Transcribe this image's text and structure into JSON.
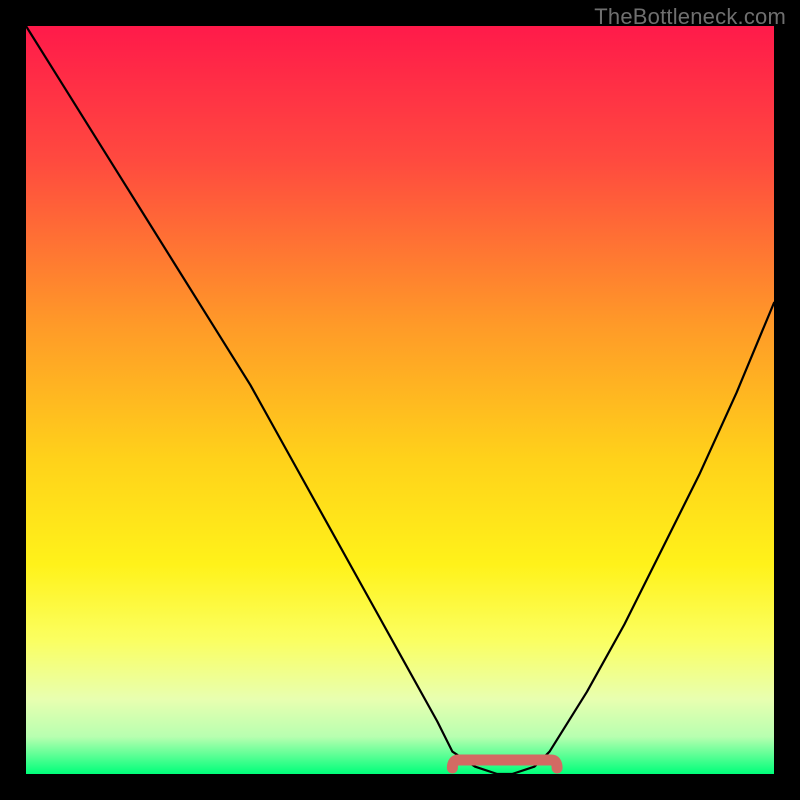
{
  "watermark": "TheBottleneck.com",
  "chart_data": {
    "type": "line",
    "title": "",
    "xlabel": "",
    "ylabel": "",
    "xlim": [
      0,
      100
    ],
    "ylim": [
      0,
      100
    ],
    "grid": false,
    "legend": false,
    "series": [
      {
        "name": "curve",
        "x": [
          0,
          5,
          10,
          15,
          20,
          25,
          30,
          35,
          40,
          45,
          50,
          55,
          57,
          60,
          63,
          65,
          68,
          70,
          75,
          80,
          85,
          90,
          95,
          100
        ],
        "y": [
          100,
          92,
          84,
          76,
          68,
          60,
          52,
          43,
          34,
          25,
          16,
          7,
          3,
          1,
          0,
          0,
          1,
          3,
          11,
          20,
          30,
          40,
          51,
          63
        ]
      }
    ],
    "marker": {
      "x_center": 64,
      "x_half_width": 7,
      "color": "#d36a63"
    },
    "gradient_stops": [
      {
        "offset": 0.0,
        "color": "#ff1a4a"
      },
      {
        "offset": 0.18,
        "color": "#ff4a3f"
      },
      {
        "offset": 0.4,
        "color": "#ff9a28"
      },
      {
        "offset": 0.58,
        "color": "#ffd21a"
      },
      {
        "offset": 0.72,
        "color": "#fff21a"
      },
      {
        "offset": 0.82,
        "color": "#fbff60"
      },
      {
        "offset": 0.9,
        "color": "#e8ffb0"
      },
      {
        "offset": 0.95,
        "color": "#b8ffb0"
      },
      {
        "offset": 1.0,
        "color": "#00ff7a"
      }
    ]
  }
}
